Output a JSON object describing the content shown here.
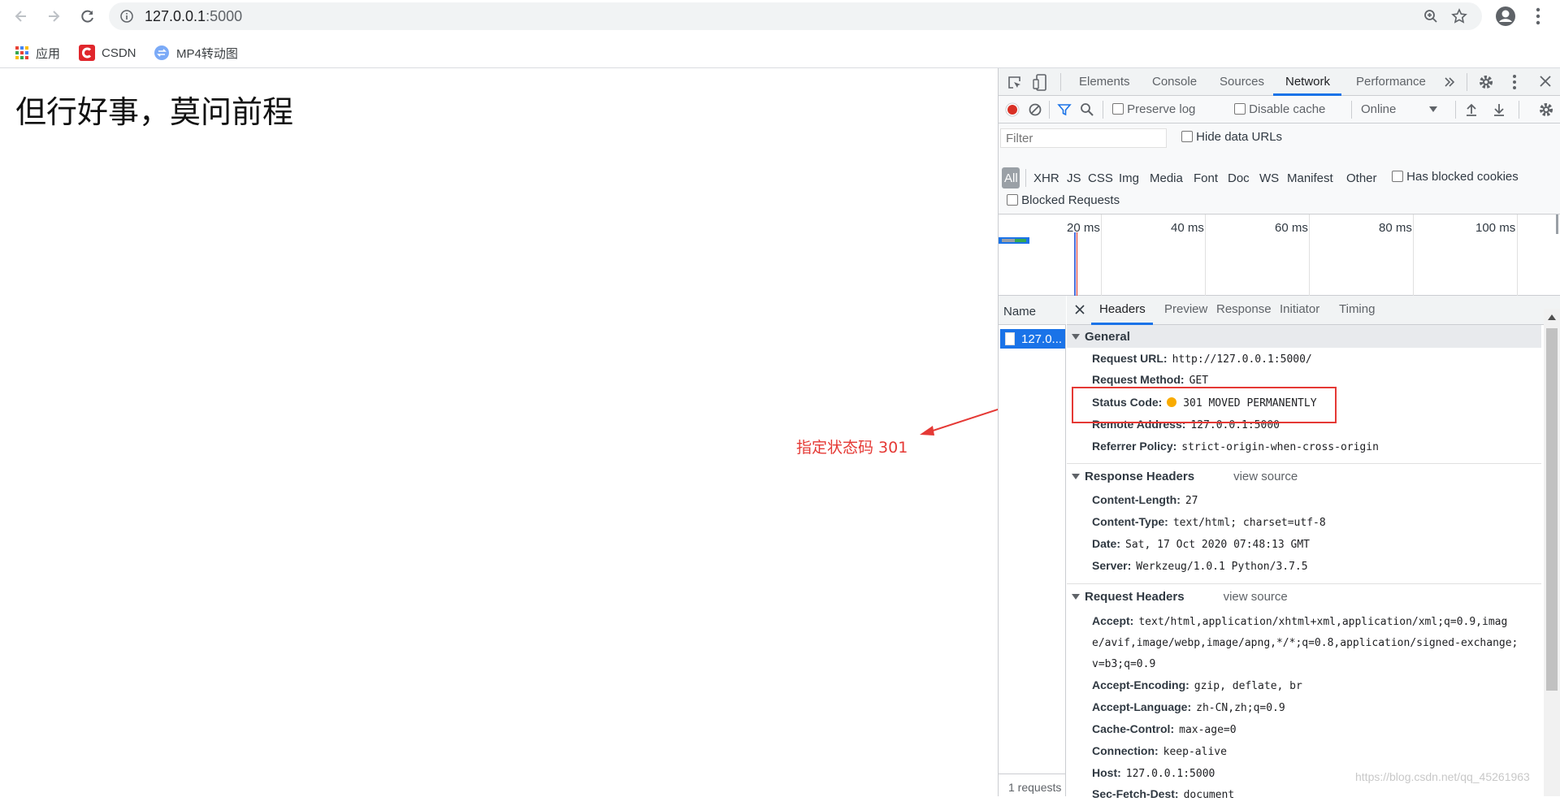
{
  "browser": {
    "url_host": "127.0.0.1",
    "url_port": ":5000",
    "bookmarks": [
      {
        "label": "应用",
        "icon": "apps-grid-icon"
      },
      {
        "label": "CSDN",
        "icon": "csdn-logo-icon"
      },
      {
        "label": "MP4转动图",
        "icon": "mp4-gif-icon"
      }
    ]
  },
  "page": {
    "heading": "但行好事，莫问前程",
    "annotation": "指定状态码 301"
  },
  "devtools": {
    "tabs": [
      "Elements",
      "Console",
      "Sources",
      "Network",
      "Performance"
    ],
    "active_tab": "Network",
    "toolbar": {
      "preserve_log": "Preserve log",
      "disable_cache": "Disable cache",
      "throttle": "Online"
    },
    "filter": {
      "placeholder": "Filter",
      "hide_data_urls": "Hide data URLs",
      "types": [
        "All",
        "XHR",
        "JS",
        "CSS",
        "Img",
        "Media",
        "Font",
        "Doc",
        "WS",
        "Manifest",
        "Other"
      ],
      "has_blocked_cookies": "Has blocked cookies",
      "blocked_requests": "Blocked Requests"
    },
    "timeline_ticks": [
      "20 ms",
      "40 ms",
      "60 ms",
      "80 ms",
      "100 ms"
    ],
    "name_header": "Name",
    "request_name": "127.0...",
    "footer": "1 requests",
    "detail_tabs": [
      "Headers",
      "Preview",
      "Response",
      "Initiator",
      "Timing"
    ],
    "general": {
      "title": "General",
      "rows": [
        {
          "k": "Request URL:",
          "v": "http://127.0.0.1:5000/"
        },
        {
          "k": "Request Method:",
          "v": "GET"
        },
        {
          "k": "Status Code:",
          "v": "301 MOVED PERMANENTLY"
        },
        {
          "k": "Remote Address:",
          "v": "127.0.0.1:5000"
        },
        {
          "k": "Referrer Policy:",
          "v": "strict-origin-when-cross-origin"
        }
      ]
    },
    "response_headers": {
      "title": "Response Headers",
      "view_source": "view source",
      "rows": [
        {
          "k": "Content-Length:",
          "v": "27"
        },
        {
          "k": "Content-Type:",
          "v": "text/html; charset=utf-8"
        },
        {
          "k": "Date:",
          "v": "Sat, 17 Oct 2020 07:48:13 GMT"
        },
        {
          "k": "Server:",
          "v": "Werkzeug/1.0.1 Python/3.7.5"
        }
      ]
    },
    "request_headers": {
      "title": "Request Headers",
      "view_source": "view source",
      "accept_key": "Accept:",
      "accept_lines": [
        "text/html,application/xhtml+xml,application/xml;q=0.9,imag",
        "e/avif,image/webp,image/apng,*/*;q=0.8,application/signed-exchange;",
        "v=b3;q=0.9"
      ],
      "rows": [
        {
          "k": "Accept-Encoding:",
          "v": "gzip, deflate, br"
        },
        {
          "k": "Accept-Language:",
          "v": "zh-CN,zh;q=0.9"
        },
        {
          "k": "Cache-Control:",
          "v": "max-age=0"
        },
        {
          "k": "Connection:",
          "v": "keep-alive"
        },
        {
          "k": "Host:",
          "v": "127.0.0.1:5000"
        },
        {
          "k": "Sec-Fetch-Dest:",
          "v": "document"
        }
      ]
    },
    "status_color": "#f9ab00",
    "highlight_color": "#e53935"
  },
  "watermark": "https://blog.csdn.net/qq_45261963"
}
